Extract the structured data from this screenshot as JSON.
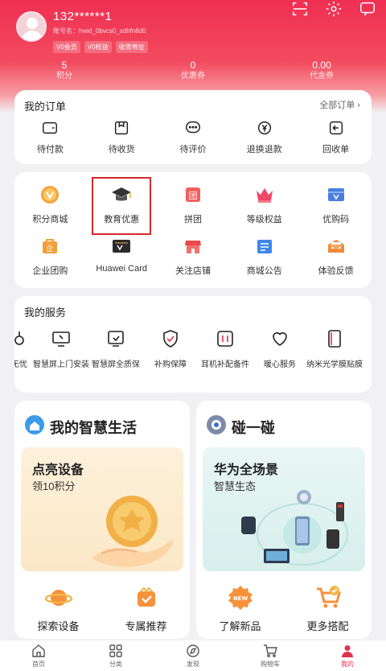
{
  "profile": {
    "username": "132******1",
    "account_label": "账号名：hwid_0bvcs0_sdhfn8d0",
    "badges": [
      "V0会员",
      "V0权益",
      "收货地址"
    ]
  },
  "stats": [
    {
      "value": "5",
      "label": "积分"
    },
    {
      "value": "0",
      "label": "优惠券"
    },
    {
      "value": "0.00",
      "label": "代金券"
    }
  ],
  "orders": {
    "title": "我的订单",
    "more": "全部订单",
    "items": [
      "待付款",
      "待收货",
      "待评价",
      "退换退款",
      "回收单"
    ]
  },
  "features": {
    "items": [
      "积分商城",
      "教育优惠",
      "拼团",
      "等级权益",
      "优购码",
      "企业团购",
      "Huawei Card",
      "关注店铺",
      "商城公告",
      "体验反馈"
    ]
  },
  "services": {
    "title": "我的服务",
    "items": [
      "无忧",
      "智慧屏上门安装",
      "智慧屏全质保",
      "补购保障",
      "耳机补配备件",
      "暖心服务",
      "纳米光学膜贴膜"
    ]
  },
  "life": {
    "title": "我的智慧生活",
    "promo_title": "点亮设备",
    "promo_sub": "领10积分",
    "actions": [
      "探索设备",
      "专属推荐"
    ]
  },
  "touch": {
    "title": "碰一碰",
    "promo_title": "华为全场景",
    "promo_sub": "智慧生态",
    "actions": [
      "了解新品",
      "更多搭配"
    ]
  },
  "tabbar": {
    "items": [
      "首页",
      "分类",
      "发现",
      "购物车",
      "我的"
    ],
    "active": "我的"
  },
  "colors": {
    "brand": "#e2314e",
    "accent_orange": "#f08a2c",
    "highlight_border": "#d42a2a"
  }
}
